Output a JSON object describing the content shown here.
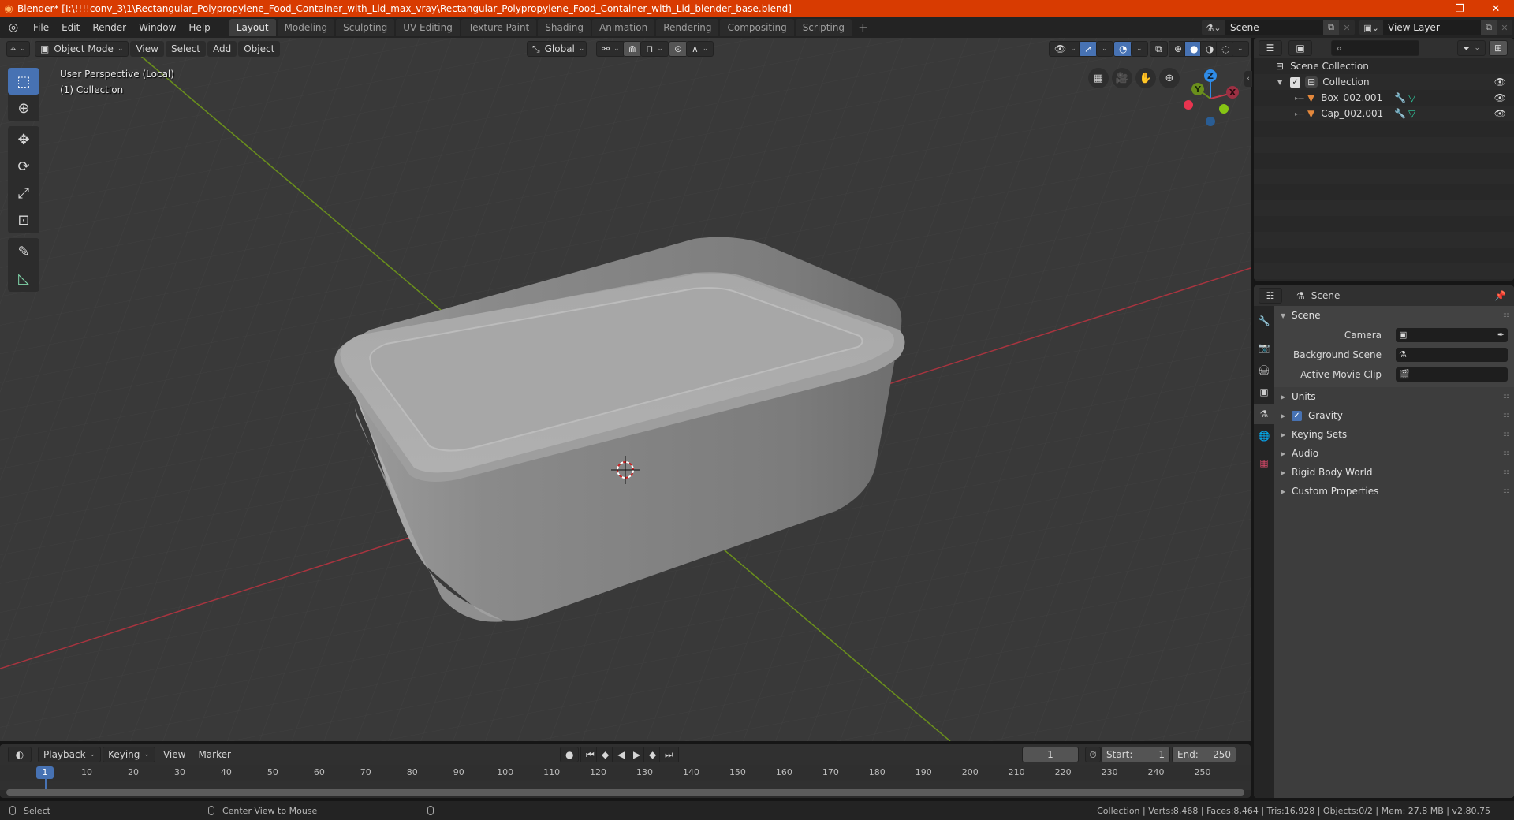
{
  "window": {
    "title": "Blender* [I:\\!!!!conv_3\\1\\Rectangular_Polypropylene_Food_Container_with_Lid_max_vray\\Rectangular_Polypropylene_Food_Container_with_Lid_blender_base.blend]",
    "minimize": "—",
    "maximize": "❐",
    "close": "✕"
  },
  "menu": [
    "File",
    "Edit",
    "Render",
    "Window",
    "Help"
  ],
  "workspaces": [
    {
      "label": "Layout",
      "active": true
    },
    {
      "label": "Modeling"
    },
    {
      "label": "Sculpting"
    },
    {
      "label": "UV Editing"
    },
    {
      "label": "Texture Paint"
    },
    {
      "label": "Shading"
    },
    {
      "label": "Animation"
    },
    {
      "label": "Rendering"
    },
    {
      "label": "Compositing"
    },
    {
      "label": "Scripting"
    }
  ],
  "workspace_add": "+",
  "scene_selector": {
    "value": "Scene"
  },
  "view_layer_selector": {
    "value": "View Layer"
  },
  "viewport": {
    "mode": "Object Mode",
    "menus": [
      "View",
      "Select",
      "Add",
      "Object"
    ],
    "orientation": "Global",
    "info_line1": "User Perspective (Local)",
    "info_line2": "(1) Collection",
    "shading_active": "solid",
    "gizmo_axes": {
      "x": "X",
      "y": "Y",
      "z": "Z"
    },
    "colors": {
      "background": "#393939",
      "axis_x": "#c2394b",
      "axis_y": "#6a8f1c",
      "axis_z": "#2f8ce8",
      "object": "#a9a9a9"
    }
  },
  "toolbar": {
    "tools": [
      "select-box",
      "cursor",
      "move",
      "rotate",
      "scale",
      "transform",
      "annotate",
      "measure"
    ],
    "active": "select-box"
  },
  "outliner": {
    "search_placeholder": "",
    "rows": [
      {
        "label": "Scene Collection",
        "type": "scene-collection"
      },
      {
        "label": "Collection",
        "type": "collection",
        "checked": true,
        "visible": true
      },
      {
        "label": "Box_002.001",
        "type": "mesh-object",
        "visible": true
      },
      {
        "label": "Cap_002.001",
        "type": "mesh-object",
        "visible": true
      }
    ]
  },
  "properties": {
    "context": "Scene",
    "panels": [
      {
        "label": "Scene",
        "expanded": true,
        "rows": [
          {
            "label": "Camera",
            "value": ""
          },
          {
            "label": "Background Scene",
            "value": ""
          },
          {
            "label": "Active Movie Clip",
            "value": ""
          }
        ]
      },
      {
        "label": "Units",
        "expanded": false
      },
      {
        "label": "Gravity",
        "expanded": false,
        "checkbox": true
      },
      {
        "label": "Keying Sets",
        "expanded": false
      },
      {
        "label": "Audio",
        "expanded": false
      },
      {
        "label": "Rigid Body World",
        "expanded": false
      },
      {
        "label": "Custom Properties",
        "expanded": false
      }
    ]
  },
  "timeline": {
    "menus": [
      "Playback",
      "Keying",
      "View",
      "Marker"
    ],
    "current_frame": "1",
    "start_label": "Start:",
    "start": "1",
    "end_label": "End:",
    "end": "250",
    "ticks": [
      "10",
      "20",
      "30",
      "40",
      "50",
      "60",
      "70",
      "80",
      "90",
      "100",
      "110",
      "120",
      "130",
      "140",
      "150",
      "160",
      "170",
      "180",
      "190",
      "200",
      "210",
      "220",
      "230",
      "240",
      "250"
    ],
    "frame_badge": "1"
  },
  "statusbar": {
    "left_action": "Select",
    "middle_action": "Center View to Mouse",
    "stats": "Collection | Verts:8,468 | Faces:8,464 | Tris:16,928 | Objects:0/2 | Mem: 27.8 MB | v2.80.75"
  }
}
